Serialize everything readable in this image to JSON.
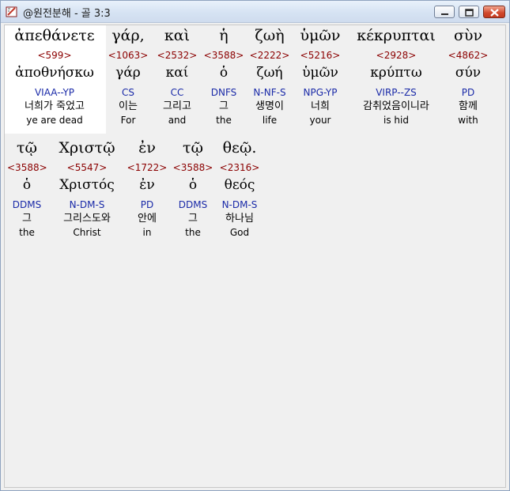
{
  "window": {
    "title": "@원전분해 - 골 3:3",
    "colors": {
      "strong": "#8b0000",
      "parsing": "#1a2aa8",
      "highlight_bg": "#ffffff"
    }
  },
  "rows": [
    {
      "words": [
        {
          "greek": "ἀπεθάνετε",
          "strong": "<599>",
          "lemma": "ἀποθνήσκω",
          "parsing": "VIAA--YP",
          "korean": "너희가 죽었고",
          "english": "ye are dead",
          "selected": true
        },
        {
          "greek": "γάρ,",
          "strong": "<1063>",
          "lemma": "γάρ",
          "parsing": "CS",
          "korean": "이는",
          "english": "For"
        },
        {
          "greek": "καὶ",
          "strong": "<2532>",
          "lemma": "καί",
          "parsing": "CC",
          "korean": "그리고",
          "english": "and"
        },
        {
          "greek": "ἡ",
          "strong": "<3588>",
          "lemma": "ὁ",
          "parsing": "DNFS",
          "korean": "그",
          "english": "the"
        },
        {
          "greek": "ζωὴ",
          "strong": "<2222>",
          "lemma": "ζωή",
          "parsing": "N-NF-S",
          "korean": "생명이",
          "english": "life"
        },
        {
          "greek": "ὑμῶν",
          "strong": "<5216>",
          "lemma": "ὑμῶν",
          "parsing": "NPG-YP",
          "korean": "너희",
          "english": "your"
        },
        {
          "greek": "κέκρυπται",
          "strong": "<2928>",
          "lemma": "κρύπτω",
          "parsing": "VIRP--ZS",
          "korean": "감취었음이니라",
          "english": "is hid"
        },
        {
          "greek": "σὺν",
          "strong": "<4862>",
          "lemma": "σύν",
          "parsing": "PD",
          "korean": "함께",
          "english": "with"
        }
      ]
    },
    {
      "words": [
        {
          "greek": "τῷ",
          "strong": "<3588>",
          "lemma": "ὁ",
          "parsing": "DDMS",
          "korean": "그",
          "english": "the"
        },
        {
          "greek": "Χριστῷ",
          "strong": "<5547>",
          "lemma": "Χριστός",
          "parsing": "N-DM-S",
          "korean": "그리스도와",
          "english": "Christ"
        },
        {
          "greek": "ἐν",
          "strong": "<1722>",
          "lemma": "ἐν",
          "parsing": "PD",
          "korean": "안에",
          "english": "in"
        },
        {
          "greek": "τῷ",
          "strong": "<3588>",
          "lemma": "ὁ",
          "parsing": "DDMS",
          "korean": "그",
          "english": "the"
        },
        {
          "greek": "θεῷ.",
          "strong": "<2316>",
          "lemma": "θεός",
          "parsing": "N-DM-S",
          "korean": "하나님",
          "english": "God"
        }
      ]
    }
  ]
}
